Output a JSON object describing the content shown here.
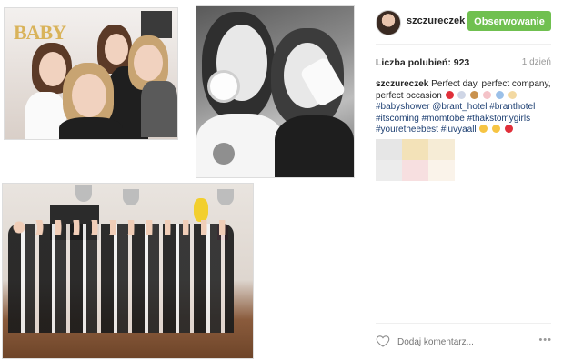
{
  "post": {
    "username": "szczureczek",
    "follow_label": "Obserwowanie",
    "likes_label": "Liczba polubień: 923",
    "time_ago": "1 dzień",
    "caption": {
      "username": "szczureczek",
      "line1": "Perfect day, perfect company, perfect occasion",
      "tags": [
        "#babyshower",
        "@brant_hotel",
        "#branthotel",
        "#itscoming",
        "#momtobe",
        "#thakstomygirls",
        "#youretheebest",
        "#luvyaall"
      ]
    },
    "comment_placeholder": "Dodaj komentarz...",
    "more_glyph": "•••"
  },
  "photos": {
    "p1_letters": "BABY"
  },
  "colors": {
    "follow_green": "#70c050",
    "hashtag_blue": "#1d3f72",
    "muted_gray": "#999999"
  },
  "icons": {
    "like": "heart-outline-icon",
    "more": "more-options-icon",
    "avatar": "user-avatar"
  }
}
